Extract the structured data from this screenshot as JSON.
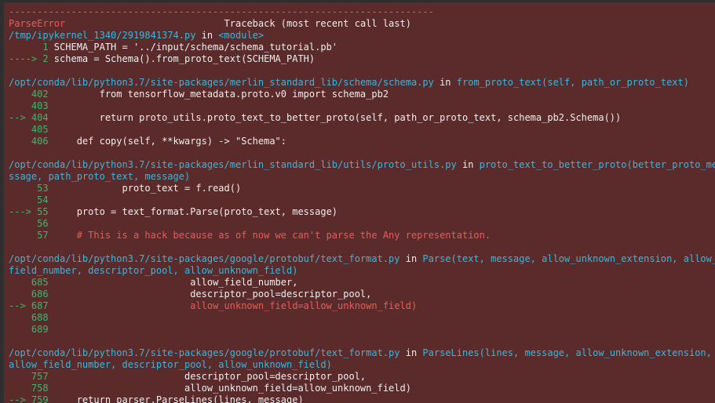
{
  "colors": {
    "background": "#5b2b2b",
    "error_red": "#e75c58",
    "path_cyan": "#3ab6da",
    "line_no_green": "#3fb46c",
    "text": "#eeeeee"
  },
  "header": {
    "separator": "---------------------------------------------------------------------------",
    "error_type": "ParseError",
    "traceback_title": "Traceback (most recent call last)"
  },
  "frames": [
    {
      "path": "/tmp/ipykernel_1340/2919841374.py",
      "in": " in ",
      "func": "<module>",
      "lines": [
        {
          "marker": "      1 ",
          "code": "SCHEMA_PATH = '../input/schema/schema_tutorial.pb'"
        },
        {
          "marker": "----> 2 ",
          "code": "schema = Schema().from_proto_text(SCHEMA_PATH)"
        }
      ]
    },
    {
      "path": "/opt/conda/lib/python3.7/site-packages/merlin_standard_lib/schema/schema.py",
      "in": " in ",
      "func": "from_proto_text(self, path_or_proto_text)",
      "lines": [
        {
          "marker": "    402 ",
          "code": "        from tensorflow_metadata.proto.v0 import schema_pb2"
        },
        {
          "marker": "    403 ",
          "code": ""
        },
        {
          "marker": "--> 404 ",
          "code": "        return proto_utils.proto_text_to_better_proto(self, path_or_proto_text, schema_pb2.Schema())"
        },
        {
          "marker": "    405 ",
          "code": ""
        },
        {
          "marker": "    406 ",
          "code": "    def copy(self, **kwargs) -> \"Schema\":"
        }
      ]
    },
    {
      "path": "/opt/conda/lib/python3.7/site-packages/merlin_standard_lib/utils/proto_utils.py",
      "in": " in ",
      "func_line1": "proto_text_to_better_proto(better_proto_me",
      "func_line2": "ssage, path_proto_text, message)",
      "lines": [
        {
          "marker": "     53 ",
          "code": "            proto_text = f.read()"
        },
        {
          "marker": "     54 ",
          "code": ""
        },
        {
          "marker": "---> 55 ",
          "code": "    proto = text_format.Parse(proto_text, message)"
        },
        {
          "marker": "     56 ",
          "code": ""
        },
        {
          "marker": "     57 ",
          "code": "    # This is a hack because as of now we can't parse the Any representation."
        }
      ]
    },
    {
      "path": "/opt/conda/lib/python3.7/site-packages/google/protobuf/text_format.py",
      "in": " in ",
      "func_line1": "Parse(text, message, allow_unknown_extension, allow_",
      "func_line2": "field_number, descriptor_pool, allow_unknown_field)",
      "lines": [
        {
          "marker": "    685 ",
          "code": "                        allow_field_number,"
        },
        {
          "marker": "    686 ",
          "code": "                        descriptor_pool=descriptor_pool,"
        },
        {
          "marker": "--> 687 ",
          "code": "                        allow_unknown_field=allow_unknown_field)"
        },
        {
          "marker": "    688 ",
          "code": ""
        },
        {
          "marker": "    689 ",
          "code": ""
        }
      ]
    },
    {
      "path": "/opt/conda/lib/python3.7/site-packages/google/protobuf/text_format.py",
      "in": " in ",
      "func_line1": "ParseLines(lines, message, allow_unknown_extension,",
      "func_line2": "allow_field_number, descriptor_pool, allow_unknown_field)",
      "lines": [
        {
          "marker": "    757 ",
          "code": "                       descriptor_pool=descriptor_pool,"
        },
        {
          "marker": "    758 ",
          "code": "                       allow_unknown_field=allow_unknown_field)"
        },
        {
          "marker": "--> 759 ",
          "code": "    return parser.ParseLines(lines, message)"
        }
      ]
    }
  ]
}
